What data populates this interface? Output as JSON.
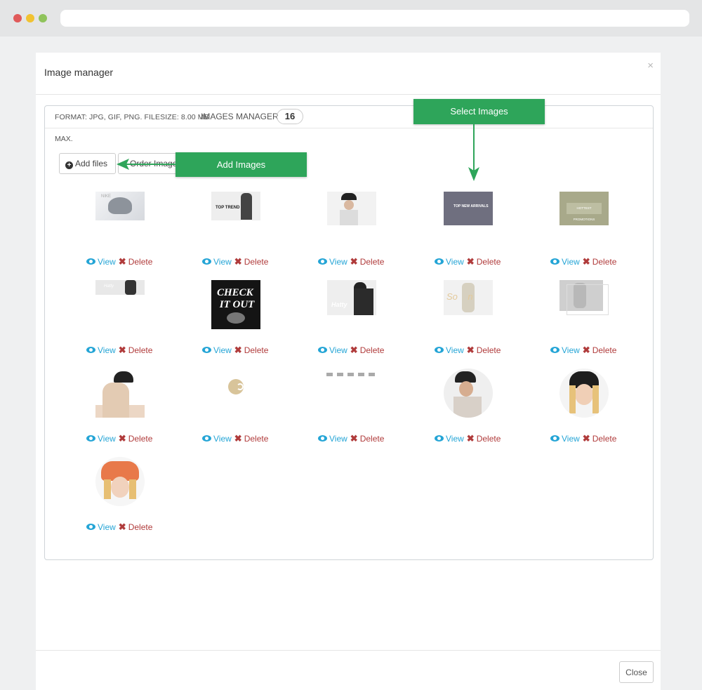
{
  "modal": {
    "title": "Image manager",
    "close_glyph": "×",
    "close_label": "Close"
  },
  "panel": {
    "format_text": "FORMAT: JPG, GIF, PNG. FILESIZE: 8.00 MB",
    "manager_label": "IMAGES MANAGER",
    "count": "16",
    "max_text": "MAX.",
    "add_files_label": "Add files",
    "order_label": "Order Image Box"
  },
  "callouts": {
    "add_images": "Add Images",
    "select_images": "Select Images"
  },
  "actions": {
    "view_label": "View",
    "delete_label": "Delete",
    "view_icon": "eye-icon",
    "delete_icon": "times-icon"
  },
  "images": [
    {
      "name": "product-cap-banner",
      "text": ""
    },
    {
      "name": "top-trend-banner",
      "text": "TOP TREND"
    },
    {
      "name": "man-cap-photo",
      "text": ""
    },
    {
      "name": "new-arrivals-banner",
      "text": "TOP NEW ARRIVALS"
    },
    {
      "name": "hottest-promotions-banner",
      "text": "HOTTEST PROMOTIONS"
    },
    {
      "name": "slim-banner",
      "text": ""
    },
    {
      "name": "check-it-out-banner",
      "text": "CHECK IT OUT"
    },
    {
      "name": "new-arrivals-hatty-banner",
      "text": "New Arrivals HATTY"
    },
    {
      "name": "so-cool-banner",
      "text": "So On"
    },
    {
      "name": "man-grey-cap-banner",
      "text": ""
    },
    {
      "name": "woman-bucket-hat-photo",
      "text": ""
    },
    {
      "name": "logo-mark",
      "text": ""
    },
    {
      "name": "payment-icons",
      "text": ""
    },
    {
      "name": "man-cap-avatar",
      "text": ""
    },
    {
      "name": "woman-black-hat-avatar",
      "text": ""
    },
    {
      "name": "woman-orange-hat-avatar",
      "text": ""
    }
  ]
}
